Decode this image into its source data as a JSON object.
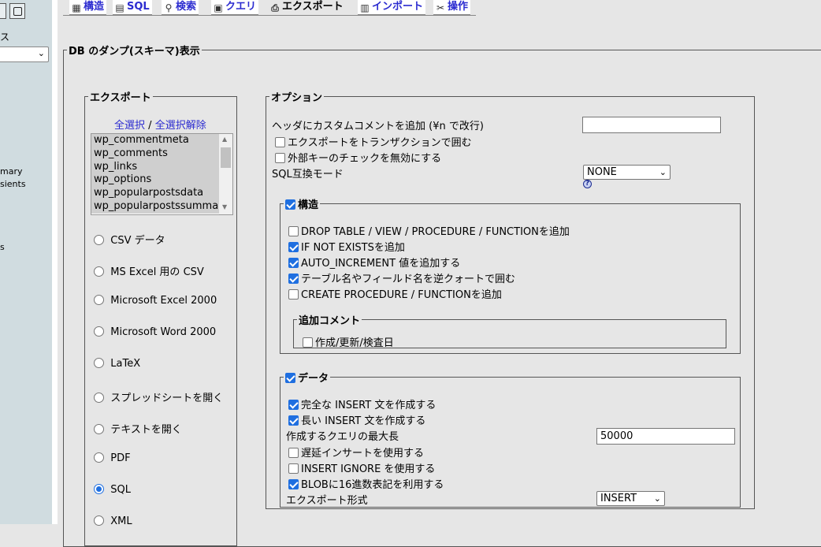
{
  "sidebar": {
    "label_top": "ス",
    "item_summary": "mary",
    "item_transients": "sients",
    "item_s": "s"
  },
  "tabs": [
    {
      "label": "構造",
      "icon": "structure-icon"
    },
    {
      "label": "SQL",
      "icon": "sql-icon"
    },
    {
      "label": "検索",
      "icon": "search-icon"
    },
    {
      "label": "クエリ",
      "icon": "query-icon"
    },
    {
      "label": "エクスポート",
      "icon": "export-icon",
      "active": true
    },
    {
      "label": "インポート",
      "icon": "import-icon"
    },
    {
      "label": "操作",
      "icon": "operations-icon"
    }
  ],
  "dump": {
    "legend": "DB のダンプ(スキーマ)表示"
  },
  "export": {
    "legend": "エクスポート",
    "select_all": "全選択",
    "separator": "/",
    "deselect_all": "全選択解除",
    "tables": [
      "wp_commentmeta",
      "wp_comments",
      "wp_links",
      "wp_options",
      "wp_popularpostsdata",
      "wp_popularpostssummary"
    ],
    "formats": [
      {
        "label": "CSV データ",
        "selected": false
      },
      {
        "label": "MS Excel 用の CSV",
        "selected": false
      },
      {
        "label": "Microsoft Excel 2000",
        "selected": false
      },
      {
        "label": "Microsoft Word 2000",
        "selected": false
      },
      {
        "label": "LaTeX",
        "selected": false
      },
      {
        "label": "スプレッドシートを開く",
        "selected": false
      },
      {
        "label": "テキストを開く",
        "selected": false
      },
      {
        "label": "PDF",
        "selected": false
      },
      {
        "label": "SQL",
        "selected": true
      },
      {
        "label": "XML",
        "selected": false
      }
    ]
  },
  "options": {
    "legend": "オプション",
    "header_comment_label": "ヘッダにカスタムコメントを追加 (¥n で改行)",
    "header_comment_value": "",
    "transaction": {
      "label": "エクスポートをトランザクションで囲む",
      "checked": false
    },
    "disable_fk": {
      "label": "外部キーのチェックを無効にする",
      "checked": false
    },
    "compat_label": "SQL互換モード",
    "compat_value": "NONE",
    "help_icon": "?",
    "structure": {
      "legend": "構造",
      "checked": true,
      "items": [
        {
          "label": "DROP TABLE / VIEW / PROCEDURE / FUNCTIONを追加",
          "checked": false
        },
        {
          "label": "IF NOT EXISTSを追加",
          "checked": true
        },
        {
          "label": "AUTO_INCREMENT 値を追加する",
          "checked": true
        },
        {
          "label": "テーブル名やフィールド名を逆クォートで囲む",
          "checked": true
        },
        {
          "label": "CREATE PROCEDURE / FUNCTIONを追加",
          "checked": false
        }
      ],
      "comments": {
        "legend": "追加コメント",
        "item": {
          "label": "作成/更新/検査日",
          "checked": false
        }
      }
    },
    "data": {
      "legend": "データ",
      "checked": true,
      "complete_insert": {
        "label": "完全な INSERT 文を作成する",
        "checked": true
      },
      "extended_insert": {
        "label": "長い INSERT 文を作成する",
        "checked": true
      },
      "max_query_label": "作成するクエリの最大長",
      "max_query_value": "50000",
      "delayed_insert": {
        "label": "遅延インサートを使用する",
        "checked": false
      },
      "insert_ignore": {
        "label": "INSERT IGNORE を使用する",
        "checked": false
      },
      "hex_blob": {
        "label": "BLOBに16進数表記を利用する",
        "checked": true
      },
      "export_type_label": "エクスポート形式",
      "export_type_value": "INSERT"
    }
  },
  "colors": {
    "accent": "#1f6fe0",
    "link": "#2b2bd0",
    "background": "#e6e6e6"
  }
}
